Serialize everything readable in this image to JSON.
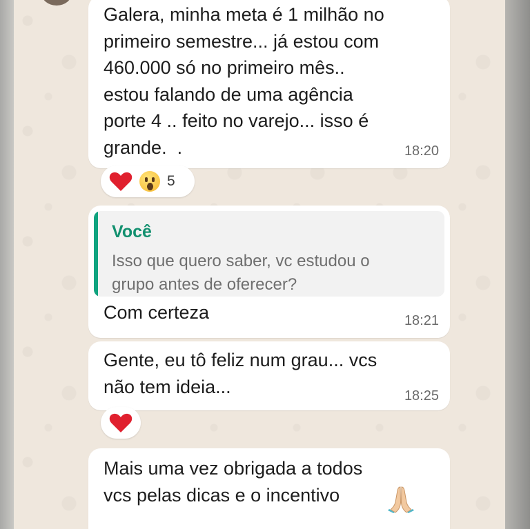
{
  "messages": [
    {
      "text": "Galera, minha meta é 1 milhão no\nprimeiro semestre... já estou com\n460.000 só no primeiro mês..\nestou falando de uma agência\nporte 4 .. feito no varejo... isso é\ngrande.  .",
      "time": "18:20",
      "reactions": {
        "emojis": [
          "heart-icon",
          "astonished-face-icon"
        ],
        "count": "5"
      }
    },
    {
      "quote": {
        "author": "Você",
        "text": "Isso que quero saber, vc estudou o\ngrupo antes de oferecer?"
      },
      "text": "Com certeza",
      "time": "18:21"
    },
    {
      "text": "Gente, eu tô feliz num grau... vcs\nnão tem ideia...",
      "time": "18:25",
      "reactions": {
        "emojis": [
          "heart-icon"
        ]
      }
    },
    {
      "text": "Mais uma vez obrigada a todos\nvcs pelas dicas e o incentivo",
      "emoji": "folded-hands-icon"
    }
  ],
  "colors": {
    "chat_background": "#efe7dd",
    "bubble": "#ffffff",
    "quote_accent": "#10a37f",
    "heart": "#e0202e"
  }
}
